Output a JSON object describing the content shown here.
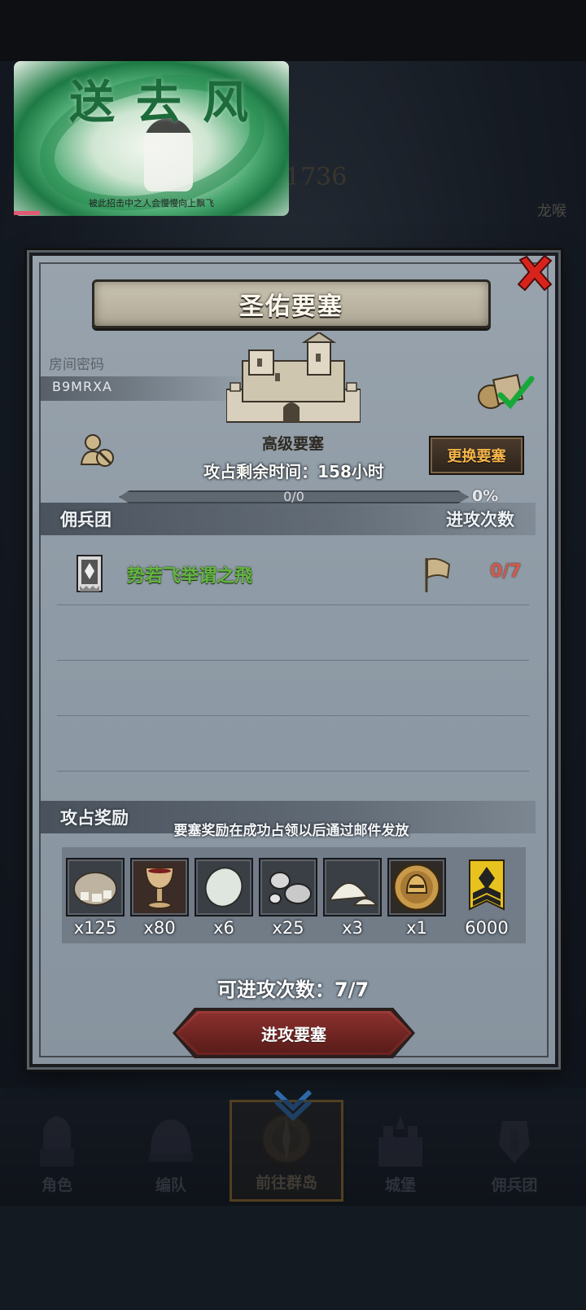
{
  "video_overlay": {
    "title": "送去风",
    "caption": "被此招击中之人会慢慢向上飘飞"
  },
  "background": {
    "number": "1736",
    "side_text": "龙喉"
  },
  "dialog": {
    "title": "圣佑要塞",
    "room": {
      "label": "房间密码",
      "code": "B9MRXA"
    },
    "fort_grade": "高级要塞",
    "change_button": "更换要塞",
    "remaining_time": "攻占剩余时间：158小时",
    "progress": {
      "text": "0/0",
      "percent_label": "0%",
      "value": 0
    },
    "mercenary_section": {
      "title": "佣兵团",
      "right_header": "进攻次数"
    },
    "guilds": [
      {
        "name": "势若飞举谓之飛",
        "attacks": "0/7"
      }
    ],
    "rewards_section": {
      "title": "攻占奖励",
      "note": "要塞奖励在成功占领以后通过邮件发放",
      "items": [
        {
          "icon": "ore-sack-icon",
          "qty": "x125"
        },
        {
          "icon": "goblet-icon",
          "qty": "x80"
        },
        {
          "icon": "egg-stone-icon",
          "qty": "x6"
        },
        {
          "icon": "silver-orbs-icon",
          "qty": "x25"
        },
        {
          "icon": "salt-pile-icon",
          "qty": "x3"
        },
        {
          "icon": "helmet-medal-icon",
          "qty": "x1"
        },
        {
          "icon": "rank-badge-icon",
          "qty": "6000"
        }
      ]
    },
    "attempts": "可进攻次数：7/7",
    "attack_button": "进攻要塞"
  },
  "bottom_nav": [
    {
      "label": "角色",
      "icon": "knight-icon"
    },
    {
      "label": "编队",
      "icon": "helmet-icon"
    },
    {
      "label": "前往群岛",
      "icon": "compass-icon",
      "active": true
    },
    {
      "label": "城堡",
      "icon": "castle-icon"
    },
    {
      "label": "佣兵团",
      "icon": "mercenary-icon"
    }
  ],
  "colors": {
    "guild_name": "#63b640",
    "attack_count": "#d35a4c",
    "change_button_text": "#f7b64a",
    "attack_button": "#8a302d",
    "panel": "#909ca7"
  }
}
